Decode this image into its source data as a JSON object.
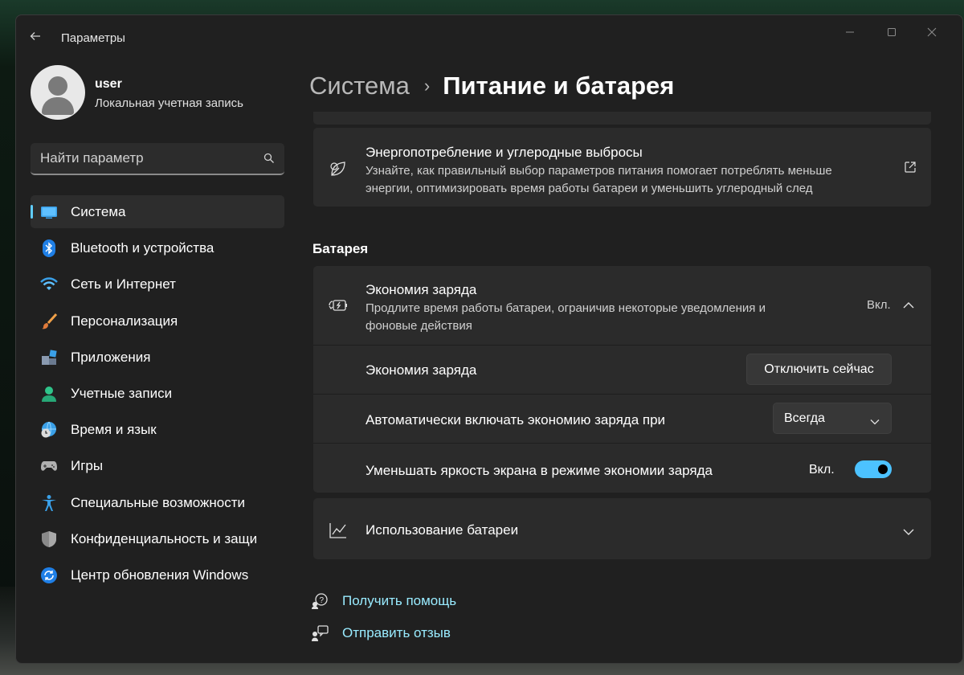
{
  "window": {
    "title": "Параметры"
  },
  "user": {
    "name": "user",
    "account_type": "Локальная учетная запись"
  },
  "search": {
    "placeholder": "Найти параметр"
  },
  "sidebar": {
    "items": [
      {
        "label": "Система",
        "icon": "monitor-icon",
        "active": true
      },
      {
        "label": "Bluetooth и устройства",
        "icon": "bluetooth-icon"
      },
      {
        "label": "Сеть и Интернет",
        "icon": "wifi-icon"
      },
      {
        "label": "Персонализация",
        "icon": "brush-icon"
      },
      {
        "label": "Приложения",
        "icon": "apps-icon"
      },
      {
        "label": "Учетные записи",
        "icon": "person-icon"
      },
      {
        "label": "Время и язык",
        "icon": "globe-clock-icon"
      },
      {
        "label": "Игры",
        "icon": "gamepad-icon"
      },
      {
        "label": "Специальные возможности",
        "icon": "accessibility-icon"
      },
      {
        "label": "Конфиденциальность и защи",
        "icon": "shield-icon"
      },
      {
        "label": "Центр обновления Windows",
        "icon": "update-icon"
      }
    ]
  },
  "breadcrumb": {
    "parent": "Система",
    "separator": "›",
    "current": "Питание и батарея"
  },
  "energy_card": {
    "title": "Энергопотребление и углеродные выбросы",
    "description": "Узнайте, как правильный выбор параметров питания помогает потреблять меньше энергии, оптимизировать время работы батареи и уменьшить углеродный след",
    "icon": "leaf-icon",
    "action_icon": "open-external-icon"
  },
  "battery_section": {
    "heading": "Батарея",
    "saver": {
      "title": "Экономия заряда",
      "description": "Продлите время работы батареи, ограничив некоторые уведомления и фоновые действия",
      "state": "Вкл.",
      "icon": "battery-saver-icon",
      "expanded": true
    },
    "saver_row": {
      "label": "Экономия заряда",
      "button": "Отключить сейчас"
    },
    "auto_row": {
      "label": "Автоматически включать экономию заряда при",
      "value": "Всегда"
    },
    "brightness_row": {
      "label": "Уменьшать яркость экрана в режиме экономии заряда",
      "state": "Вкл.",
      "on": true
    },
    "usage": {
      "title": "Использование батареи",
      "icon": "chart-line-icon",
      "expanded": false
    }
  },
  "links": {
    "help": "Получить помощь",
    "feedback": "Отправить отзыв"
  },
  "colors": {
    "accent": "#60cdff",
    "toggle_on": "#4cc2ff",
    "link": "#99ebff"
  }
}
